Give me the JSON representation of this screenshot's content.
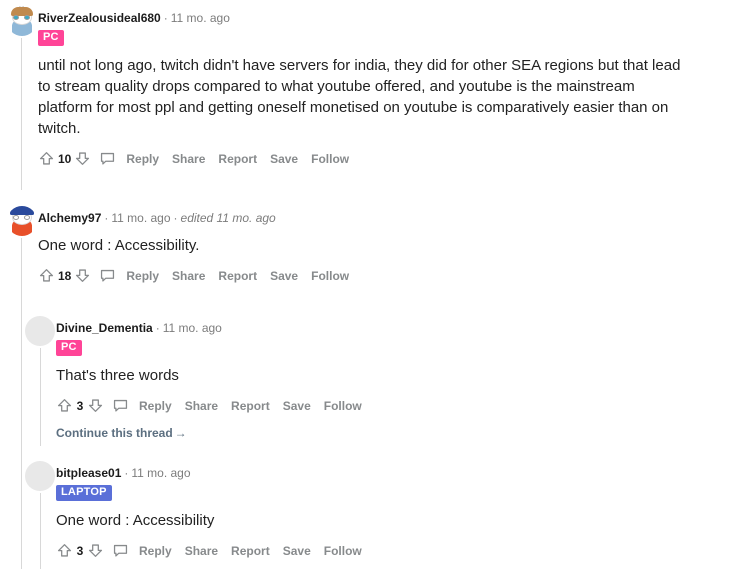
{
  "thread": {
    "comments": [
      {
        "id": "comment-1",
        "username": "RiverZealousideal680",
        "separator": "·",
        "timestamp": "11 mo. ago",
        "edited": "",
        "badge": {
          "label": "PC",
          "color": "#ff4497"
        },
        "avatar": {
          "type": "snoo",
          "hair_color": "#c08a4e",
          "body_color": "#8fb8d8",
          "has_hat": false
        },
        "text": "until not long ago, twitch didn't have servers for india, they did for other SEA regions but that lead to stream quality drops compared to what youtube offered, and youtube is the mainstream platform for most ppl and getting oneself monetised on youtube is comparatively easier than on twitch.",
        "score": "10",
        "actions": [
          "Reply",
          "Share",
          "Report",
          "Save",
          "Follow"
        ],
        "continue_link": ""
      },
      {
        "id": "comment-2",
        "username": "Alchemy97",
        "separator": "·",
        "timestamp": "11 mo. ago",
        "edited": "edited 11 mo. ago",
        "badge": null,
        "avatar": {
          "type": "snoo",
          "hair_color": "#2a4a9c",
          "body_color": "#e8502a",
          "has_hat": true
        },
        "text": "One word : Accessibility.",
        "score": "18",
        "actions": [
          "Reply",
          "Share",
          "Report",
          "Save",
          "Follow"
        ],
        "continue_link": ""
      },
      {
        "id": "comment-3",
        "username": "Divine_Dementia",
        "separator": "·",
        "timestamp": "11 mo. ago",
        "edited": "",
        "badge": {
          "label": "PC",
          "color": "#ff4497"
        },
        "avatar": {
          "type": "placeholder"
        },
        "text": "That's three words",
        "score": "3",
        "actions": [
          "Reply",
          "Share",
          "Report",
          "Save",
          "Follow"
        ],
        "continue_link": "Continue this thread"
      },
      {
        "id": "comment-4",
        "username": "bitplease01",
        "separator": "·",
        "timestamp": "11 mo. ago",
        "edited": "",
        "badge": {
          "label": "LAPTOP",
          "color": "#5a6fd8"
        },
        "avatar": {
          "type": "placeholder"
        },
        "text": "One word : Accessibility",
        "score": "3",
        "actions": [
          "Reply",
          "Share",
          "Report",
          "Save",
          "Follow"
        ],
        "continue_link": ""
      }
    ],
    "icons": {
      "upvote": "upvote-arrow-icon",
      "downvote": "downvote-arrow-icon",
      "comment": "comment-bubble-icon",
      "continue_arrow": "→"
    },
    "colors": {
      "background": "#ffffff",
      "body_text": "#222222",
      "username": "#1c1c1c",
      "muted": "#7c7c7c",
      "action": "#878a8c",
      "threadline": "#d8d8d8",
      "link": "#5c6f80"
    }
  }
}
